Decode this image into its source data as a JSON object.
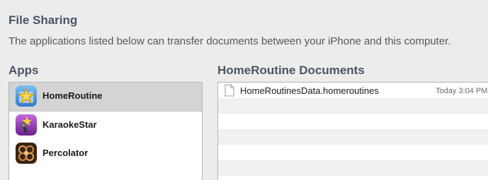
{
  "header": {
    "title": "File Sharing",
    "description": "The applications listed below can transfer documents between your iPhone and this computer."
  },
  "apps": {
    "heading": "Apps",
    "items": [
      {
        "label": "HomeRoutine",
        "icon": "homeroutine-app-icon",
        "selected": true
      },
      {
        "label": "KaraokeStar",
        "icon": "karaokestar-app-icon",
        "selected": false
      },
      {
        "label": "Percolator",
        "icon": "percolator-app-icon",
        "selected": false
      }
    ]
  },
  "documents": {
    "heading": "HomeRoutine Documents",
    "items": [
      {
        "name": "HomeRoutinesData.homeroutines",
        "date": "Today 3:04 PM",
        "icon": "document-icon"
      }
    ]
  },
  "colors": {
    "heading": "#4a5563",
    "selection": "#d4d4d4",
    "stripe": "#f0f0f0"
  }
}
